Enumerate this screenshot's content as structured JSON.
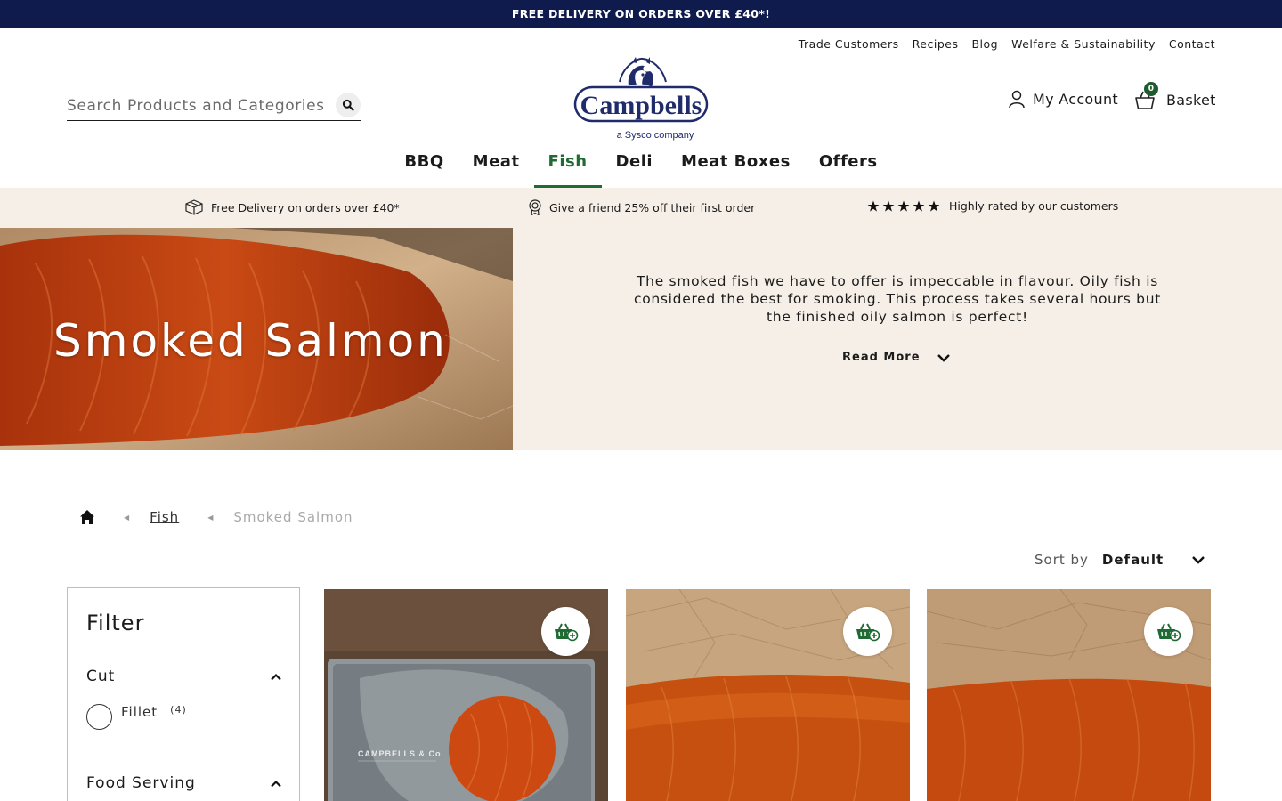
{
  "announcement": "FREE DELIVERY ON ORDERS OVER £40*!",
  "util_nav": [
    "Trade Customers",
    "Recipes",
    "Blog",
    "Welfare & Sustainability",
    "Contact"
  ],
  "search": {
    "placeholder": "Search Products and Categories"
  },
  "logo": {
    "wordmark": "Campbells",
    "tagline": "a Sysco company"
  },
  "account": {
    "label": "My Account"
  },
  "basket": {
    "label": "Basket",
    "count": "0"
  },
  "main_nav": [
    {
      "label": "BBQ",
      "active": false
    },
    {
      "label": "Meat",
      "active": false
    },
    {
      "label": "Fish",
      "active": true
    },
    {
      "label": "Deli",
      "active": false
    },
    {
      "label": "Meat Boxes",
      "active": false
    },
    {
      "label": "Offers",
      "active": false
    }
  ],
  "usps": [
    {
      "icon": "box-icon",
      "text": "Free Delivery on orders over £40*"
    },
    {
      "icon": "award-icon",
      "text": "Give a friend 25% off their first order"
    },
    {
      "icon": "five-stars-icon",
      "text": "Highly rated by our customers",
      "rating": 5
    }
  ],
  "hero": {
    "title": "Smoked Salmon",
    "description": "The smoked fish we have to offer is impeccable in flavour. Oily fish is considered the best for smoking. This process takes several hours but the finished oily salmon is perfect!",
    "read_more": "Read More"
  },
  "breadcrumb": {
    "link": "Fish",
    "current": "Smoked Salmon"
  },
  "sort": {
    "label": "Sort by",
    "value": "Default"
  },
  "filter": {
    "title": "Filter",
    "groups": [
      {
        "label": "Cut",
        "options": [
          {
            "label": "Fillet",
            "count": "(4)"
          }
        ]
      },
      {
        "label": "Food Serving"
      }
    ]
  },
  "products": [
    {
      "image": "sliced-salmon-pack",
      "package_brand": "CAMPBELLS & Co"
    },
    {
      "image": "salmon-fillet-on-paper"
    },
    {
      "image": "salmon-side-on-paper"
    }
  ],
  "colors": {
    "navy": "#0f1a4d",
    "green": "#1f6b33",
    "cream": "#f6efe7",
    "salmon": "#c94a14"
  }
}
